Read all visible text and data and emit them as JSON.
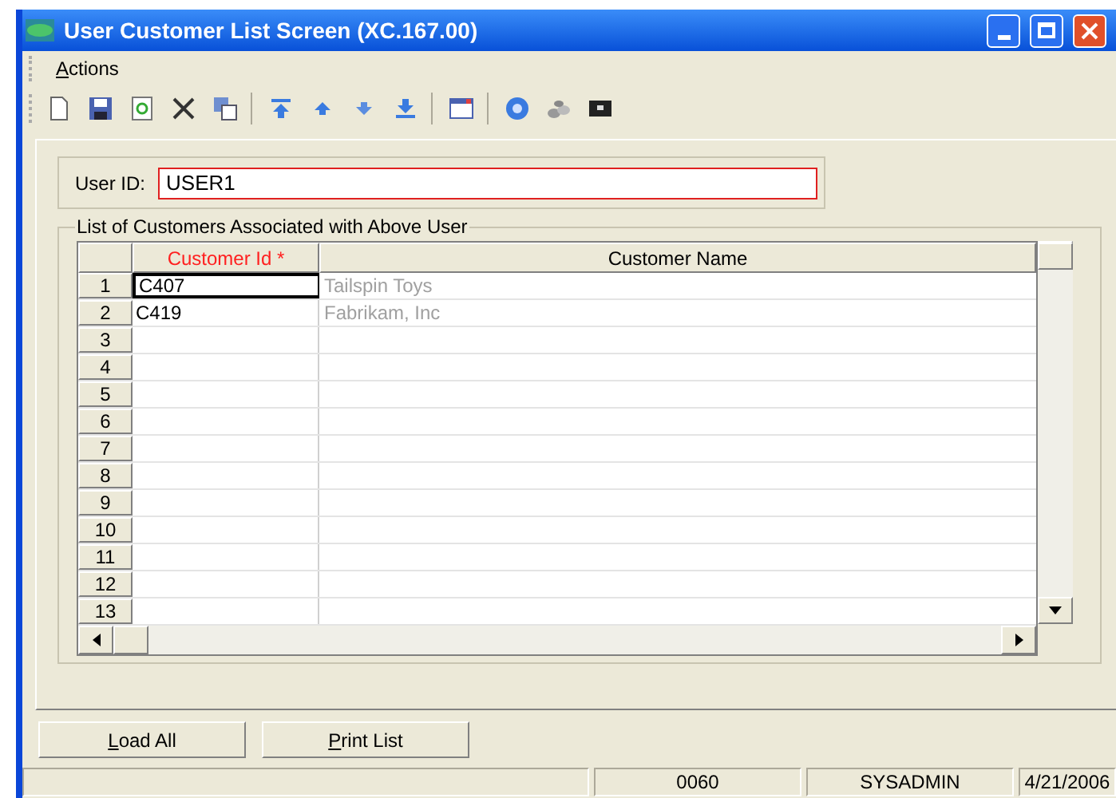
{
  "window": {
    "title": "User Customer List Screen (XC.167.00)"
  },
  "menu": [
    {
      "label": "Actions",
      "accelerator": true
    }
  ],
  "user_id": {
    "label": "User ID:",
    "value": "USER1",
    "required": true
  },
  "customer_list": {
    "title": "List of Customers Associated with Above User",
    "columns": [
      {
        "label": "Customer Id *",
        "required": true
      },
      {
        "label": "Customer Name",
        "required": false
      }
    ],
    "rows": [
      {
        "number": "1",
        "customer_id": "C407",
        "customer_name": "Tailspin Toys",
        "focused": true
      },
      {
        "number": "2",
        "customer_id": "C419",
        "customer_name": "Fabrikam, Inc",
        "focused": false
      },
      {
        "number": "3",
        "focused": false
      },
      {
        "number": "4",
        "focused": false
      },
      {
        "number": "5",
        "focused": false
      },
      {
        "number": "6",
        "focused": false
      },
      {
        "number": "7",
        "focused": false
      },
      {
        "number": "8",
        "focused": false
      },
      {
        "number": "9",
        "focused": false
      },
      {
        "number": "10",
        "focused": false
      },
      {
        "number": "11",
        "focused": false
      },
      {
        "number": "12",
        "focused": false
      },
      {
        "number": "13",
        "focused": false
      }
    ]
  },
  "buttons": [
    {
      "label": "Load All",
      "accelerator": true
    },
    {
      "label": "Print List",
      "accelerator": true
    }
  ],
  "status_bar": [
    "0060",
    "SYSADMIN",
    "4/21/2006"
  ]
}
